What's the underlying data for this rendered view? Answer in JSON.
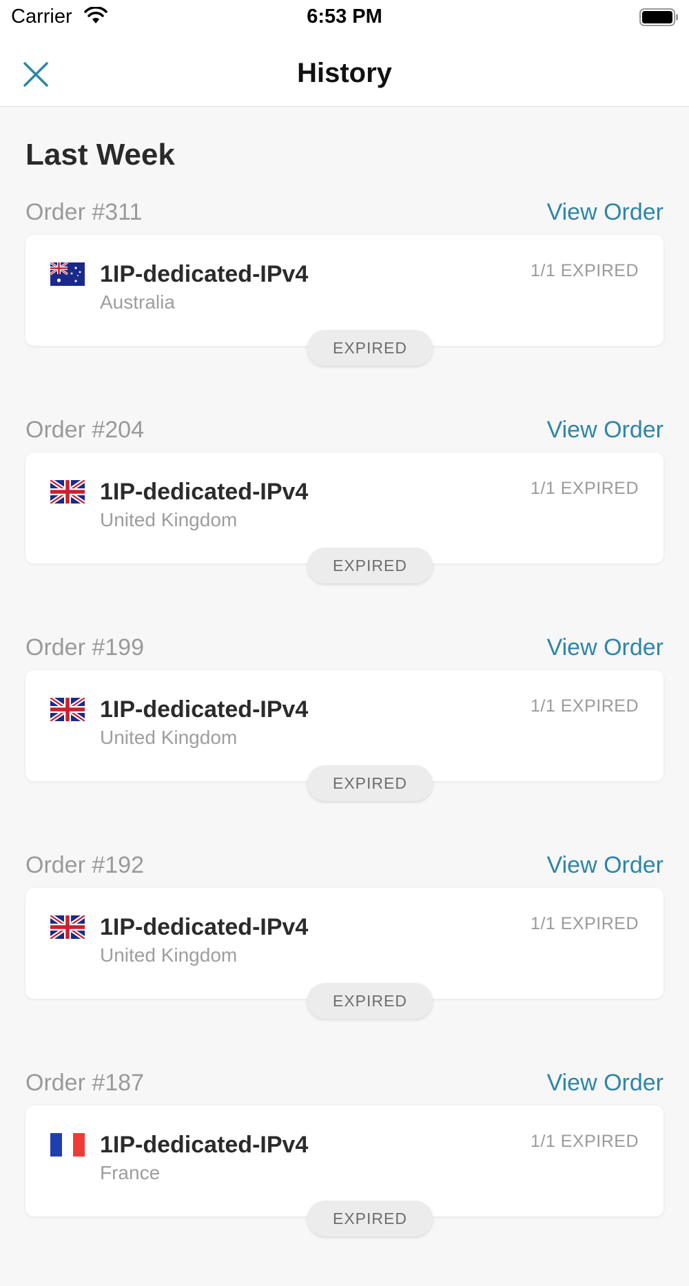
{
  "status_bar": {
    "carrier": "Carrier",
    "time": "6:53 PM"
  },
  "nav": {
    "title": "History",
    "close_icon": "close-icon"
  },
  "section": {
    "title": "Last Week"
  },
  "orders": [
    {
      "order_number": "Order #311",
      "view_label": "View Order",
      "product": "1IP-dedicated-IPv4",
      "country": "Australia",
      "flag": "australia-flag-icon",
      "count_status": "1/1 EXPIRED",
      "status_pill": "EXPIRED"
    },
    {
      "order_number": "Order #204",
      "view_label": "View Order",
      "product": "1IP-dedicated-IPv4",
      "country": "United Kingdom",
      "flag": "uk-flag-icon",
      "count_status": "1/1 EXPIRED",
      "status_pill": "EXPIRED"
    },
    {
      "order_number": "Order #199",
      "view_label": "View Order",
      "product": "1IP-dedicated-IPv4",
      "country": "United Kingdom",
      "flag": "uk-flag-icon",
      "count_status": "1/1 EXPIRED",
      "status_pill": "EXPIRED"
    },
    {
      "order_number": "Order #192",
      "view_label": "View Order",
      "product": "1IP-dedicated-IPv4",
      "country": "United Kingdom",
      "flag": "uk-flag-icon",
      "count_status": "1/1 EXPIRED",
      "status_pill": "EXPIRED"
    },
    {
      "order_number": "Order #187",
      "view_label": "View Order",
      "product": "1IP-dedicated-IPv4",
      "country": "France",
      "flag": "france-flag-icon",
      "count_status": "1/1 EXPIRED",
      "status_pill": "EXPIRED"
    }
  ],
  "colors": {
    "accent": "#2d85a8",
    "background": "#f7f7f7",
    "card": "#ffffff",
    "muted_text": "#9a9a9a",
    "pill": "#ececec"
  }
}
